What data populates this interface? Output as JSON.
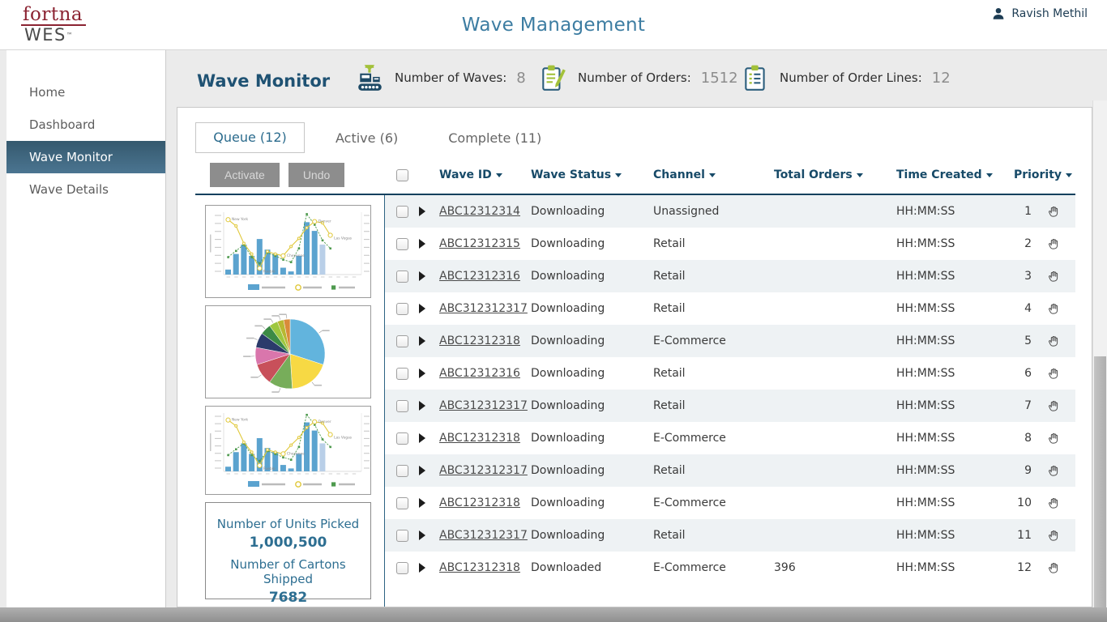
{
  "topbar": {
    "logo_line1": "fortna",
    "logo_line2": "WES",
    "logo_tm": "™",
    "title": "Wave Management",
    "user_name": "Ravish Methil"
  },
  "sidebar": {
    "items": [
      {
        "label": "Home",
        "active": false
      },
      {
        "label": "Dashboard",
        "active": false
      },
      {
        "label": "Wave Monitor",
        "active": true
      },
      {
        "label": "Wave Details",
        "active": false
      }
    ]
  },
  "monitor_header": {
    "title": "Wave Monitor",
    "stats": [
      {
        "icon": "conveyor-icon",
        "label": "Number of Waves:",
        "value": "8"
      },
      {
        "icon": "clipboard-pencil-icon",
        "label": "Number of Orders:",
        "value": "1512"
      },
      {
        "icon": "clipboard-list-icon",
        "label": "Number of Order Lines:",
        "value": "12"
      }
    ]
  },
  "tabs": [
    {
      "label": "Queue (12)",
      "active": true
    },
    {
      "label": "Active (6)",
      "active": false
    },
    {
      "label": "Complete (11)",
      "active": false
    }
  ],
  "toolbar": {
    "activate_label": "Activate",
    "undo_label": "Undo"
  },
  "table": {
    "columns": [
      "Wave ID",
      "Wave Status",
      "Channel",
      "Total Orders",
      "Time Created",
      "Priority"
    ],
    "rows": [
      {
        "wave_id": "ABC12312314",
        "status": "Downloading",
        "channel": "Unassigned",
        "total_orders": "",
        "time_created": "HH:MM:SS",
        "priority": "1"
      },
      {
        "wave_id": "ABC12312315",
        "status": "Downloading",
        "channel": "Retail",
        "total_orders": "",
        "time_created": "HH:MM:SS",
        "priority": "2"
      },
      {
        "wave_id": "ABC12312316",
        "status": "Downloading",
        "channel": "Retail",
        "total_orders": "",
        "time_created": "HH:MM:SS",
        "priority": "3"
      },
      {
        "wave_id": "ABC312312317",
        "status": "Downloading",
        "channel": "Retail",
        "total_orders": "",
        "time_created": "HH:MM:SS",
        "priority": "4"
      },
      {
        "wave_id": "ABC12312318",
        "status": "Downloading",
        "channel": "E-Commerce",
        "total_orders": "",
        "time_created": "HH:MM:SS",
        "priority": "5"
      },
      {
        "wave_id": "ABC12312316",
        "status": "Downloading",
        "channel": "Retail",
        "total_orders": "",
        "time_created": "HH:MM:SS",
        "priority": "6"
      },
      {
        "wave_id": "ABC312312317",
        "status": "Downloading",
        "channel": "Retail",
        "total_orders": "",
        "time_created": "HH:MM:SS",
        "priority": "7"
      },
      {
        "wave_id": "ABC12312318",
        "status": "Downloading",
        "channel": "E-Commerce",
        "total_orders": "",
        "time_created": "HH:MM:SS",
        "priority": "8"
      },
      {
        "wave_id": "ABC312312317",
        "status": "Downloading",
        "channel": "Retail",
        "total_orders": "",
        "time_created": "HH:MM:SS",
        "priority": "9"
      },
      {
        "wave_id": "ABC12312318",
        "status": "Downloading",
        "channel": "E-Commerce",
        "total_orders": "",
        "time_created": "HH:MM:SS",
        "priority": "10"
      },
      {
        "wave_id": "ABC312312317",
        "status": "Downloading",
        "channel": "Retail",
        "total_orders": "",
        "time_created": "HH:MM:SS",
        "priority": "11"
      },
      {
        "wave_id": "ABC12312318",
        "status": "Downloaded",
        "channel": "E-Commerce",
        "total_orders": "396",
        "time_created": "HH:MM:SS",
        "priority": "12"
      }
    ]
  },
  "summary_panel": {
    "line1_label": "Number of Units Picked",
    "line1_value": "1,000,500",
    "line2_label": "Number of Cartons Shipped",
    "line2_value": "7682"
  },
  "chart_data": [
    {
      "type": "bar",
      "subtype": "combo-bar-line-thumbnail",
      "title": "",
      "xlabel": "",
      "ylabel": "",
      "axis_text_illegible": true,
      "legend_position": "bottom",
      "legend_text_illegible": true,
      "series": [
        {
          "name": "bars",
          "type": "bar",
          "color": "#5ba3cf",
          "last_bar_color": "#b9cfe8",
          "values": [
            8,
            33,
            48,
            30,
            57,
            40,
            33,
            11,
            5,
            30,
            84,
            70,
            48
          ]
        },
        {
          "name": "line-yellow",
          "type": "line",
          "color": "#e0c83a",
          "values": [
            88,
            78,
            50,
            33,
            10,
            37,
            33,
            30,
            45,
            58,
            75,
            85,
            83,
            63
          ]
        },
        {
          "name": "line-green",
          "type": "line",
          "color": "#4e9a4e",
          "dashed": true,
          "values": [
            28,
            38,
            48,
            28,
            18,
            35,
            30,
            24,
            20,
            42,
            97,
            80,
            55,
            42
          ]
        }
      ],
      "annotations": [
        {
          "text": "New York",
          "point": 0
        },
        {
          "text": "Pueblo",
          "point": 4
        },
        {
          "text": "Cheyenne",
          "point": 7
        },
        {
          "text": "Denver",
          "point": 11
        },
        {
          "text": "Las Vegas",
          "point": 13
        }
      ]
    },
    {
      "type": "pie",
      "labels_illegible": true,
      "slices": [
        {
          "color": "#62b4dd",
          "value": 30
        },
        {
          "color": "#f7d944",
          "value": 19
        },
        {
          "color": "#77ad5a",
          "value": 11
        },
        {
          "color": "#c8505a",
          "value": 10
        },
        {
          "color": "#d976ac",
          "value": 8
        },
        {
          "color": "#2b3b6b",
          "value": 7
        },
        {
          "color": "#3c8a45",
          "value": 5
        },
        {
          "color": "#9ec73f",
          "value": 4
        },
        {
          "color": "#b8b832",
          "value": 3
        },
        {
          "color": "#d98b3a",
          "value": 3
        }
      ]
    },
    {
      "type": "bar",
      "subtype": "combo-bar-line-thumbnail",
      "same_as_chart_index": 0,
      "series": [
        {
          "name": "bars",
          "type": "bar",
          "color": "#5ba3cf",
          "last_bar_color": "#b9cfe8",
          "values": [
            8,
            33,
            48,
            30,
            57,
            40,
            33,
            11,
            5,
            30,
            84,
            70,
            48
          ]
        },
        {
          "name": "line-yellow",
          "type": "line",
          "color": "#e0c83a",
          "values": [
            88,
            78,
            50,
            33,
            10,
            37,
            33,
            30,
            45,
            58,
            75,
            85,
            83,
            63
          ]
        },
        {
          "name": "line-green",
          "type": "line",
          "color": "#4e9a4e",
          "dashed": true,
          "values": [
            28,
            38,
            48,
            28,
            18,
            35,
            30,
            24,
            20,
            42,
            97,
            80,
            55,
            42
          ]
        }
      ],
      "annotations": [
        {
          "text": "New York",
          "point": 0
        },
        {
          "text": "Pueblo",
          "point": 4
        },
        {
          "text": "Cheyenne",
          "point": 7
        },
        {
          "text": "Denver",
          "point": 11
        },
        {
          "text": "Las Vegas",
          "point": 13
        }
      ]
    }
  ],
  "colors": {
    "accent_teal": "#2e6e8e",
    "header_navy": "#174a68",
    "underline_navy": "#10405e",
    "brand_maroon": "#8b2332",
    "brand_green": "#a3c13a",
    "nav_active_top": "#35596e",
    "nav_active_bottom": "#4b7591",
    "row_stripe": "#eef2f4",
    "bar_blue": "#5ba3cf",
    "bar_light": "#b9cfe8"
  }
}
